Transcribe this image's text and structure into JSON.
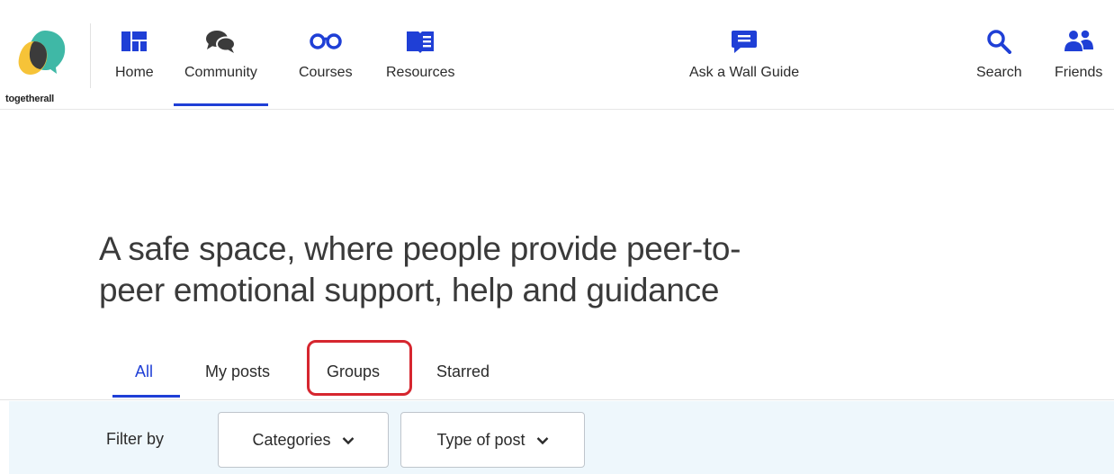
{
  "brand": {
    "name": "togetherall",
    "colors": {
      "yellow": "#f6c338",
      "teal": "#3fb8a6",
      "dark": "#3b3b3b"
    }
  },
  "nav": {
    "accent_color": "#1f3fd6",
    "items": [
      {
        "label": "Home",
        "icon": "dashboard-icon"
      },
      {
        "label": "Community",
        "icon": "chat-bubbles-icon",
        "active": true
      },
      {
        "label": "Courses",
        "icon": "glasses-icon"
      },
      {
        "label": "Resources",
        "icon": "book-icon"
      },
      {
        "label": "Ask a Wall Guide",
        "icon": "message-icon"
      },
      {
        "label": "Search",
        "icon": "search-icon"
      },
      {
        "label": "Friends",
        "icon": "friends-icon"
      }
    ]
  },
  "hero": {
    "title_line1": "A safe space, where people provide peer-to-",
    "title_line2": "peer emotional support, help and guidance"
  },
  "tabs": {
    "items": [
      {
        "label": "All",
        "active": true
      },
      {
        "label": "My posts"
      },
      {
        "label": "Groups",
        "highlighted": true
      },
      {
        "label": "Starred"
      }
    ]
  },
  "filters": {
    "label": "Filter by",
    "dropdowns": [
      {
        "label": "Categories",
        "icon": "chevron-down-icon"
      },
      {
        "label": "Type of post",
        "icon": "chevron-down-icon"
      }
    ]
  },
  "annotation": {
    "color": "#d6262f"
  }
}
